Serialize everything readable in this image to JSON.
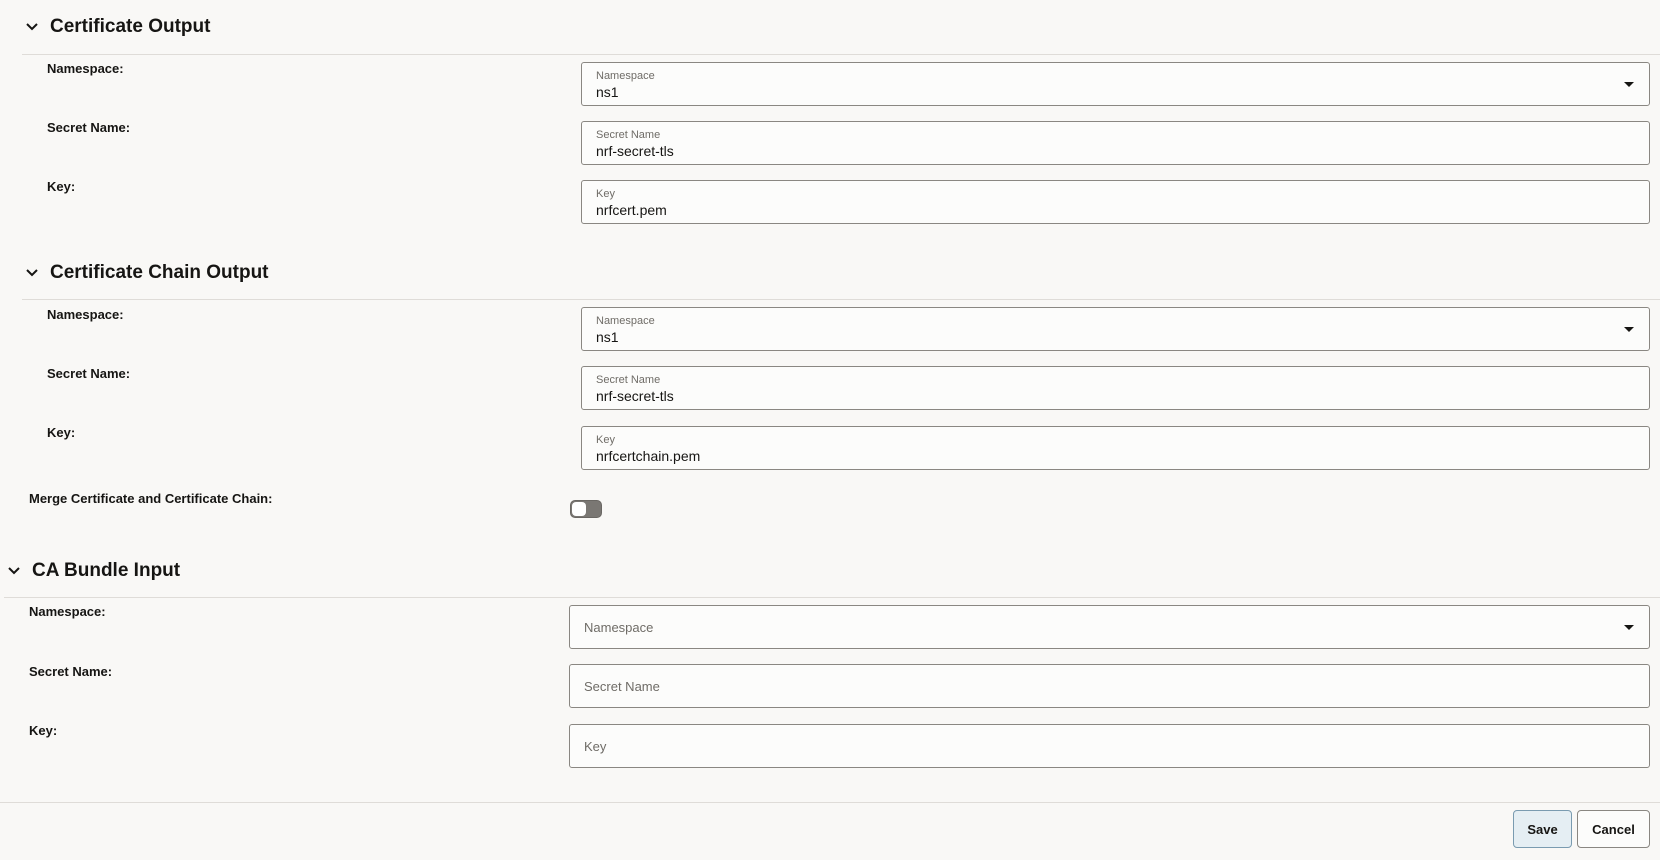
{
  "sections": {
    "cert_output": {
      "title": "Certificate Output",
      "namespace": {
        "label": "Namespace:",
        "field_label": "Namespace",
        "value": "ns1"
      },
      "secret_name": {
        "label": "Secret Name:",
        "field_label": "Secret Name",
        "value": "nrf-secret-tls"
      },
      "key": {
        "label": "Key:",
        "field_label": "Key",
        "value": "nrfcert.pem"
      }
    },
    "chain_output": {
      "title": "Certificate Chain Output",
      "namespace": {
        "label": "Namespace:",
        "field_label": "Namespace",
        "value": "ns1"
      },
      "secret_name": {
        "label": "Secret Name:",
        "field_label": "Secret Name",
        "value": "nrf-secret-tls"
      },
      "key": {
        "label": "Key:",
        "field_label": "Key",
        "value": "nrfcertchain.pem"
      },
      "merge": {
        "label": "Merge Certificate and Certificate Chain:",
        "enabled": false
      }
    },
    "ca_bundle": {
      "title": "CA Bundle Input",
      "namespace": {
        "label": "Namespace:",
        "placeholder": "Namespace"
      },
      "secret_name": {
        "label": "Secret Name:",
        "placeholder": "Secret Name"
      },
      "key": {
        "label": "Key:",
        "placeholder": "Key"
      }
    }
  },
  "footer": {
    "save_label": "Save",
    "cancel_label": "Cancel"
  },
  "icons": {
    "section_toggle": "chevron-down-icon",
    "dropdown": "caret-down-icon"
  },
  "colors": {
    "background": "#f9f8f6",
    "field_border": "#8a8782",
    "save_button_bg": "#e5eef3"
  }
}
